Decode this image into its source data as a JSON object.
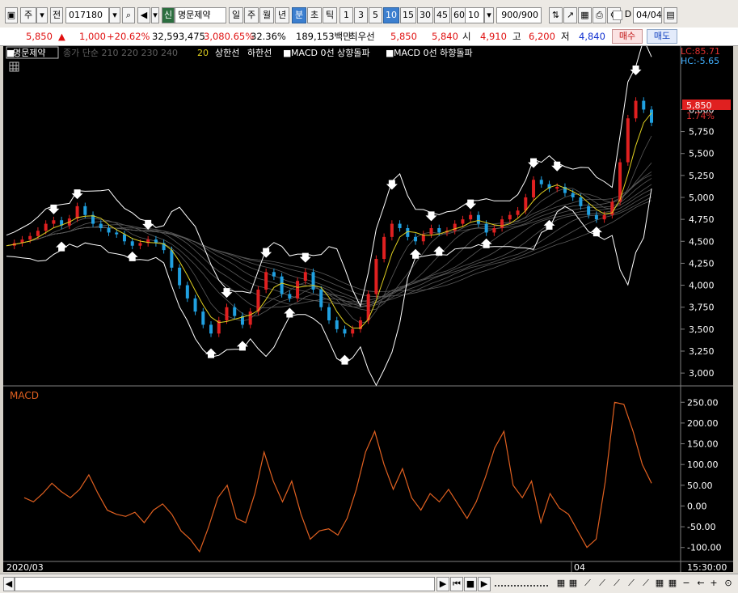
{
  "toolbar": {
    "market_label": "주",
    "prev_label": "전",
    "code": "017180",
    "new_badge": "신",
    "stock_name": "명문제약",
    "period_day": "일",
    "period_week": "주",
    "period_month": "월",
    "period_year": "년",
    "period_minute": "분",
    "period_second": "초",
    "period_tick": "틱",
    "intervals": [
      "1",
      "3",
      "5",
      "10",
      "15",
      "30",
      "45",
      "60"
    ],
    "selected_interval": "10",
    "interval_combo": "10",
    "count_display": "900/900",
    "date_display": "04/04",
    "d_label": "D"
  },
  "quote": {
    "price": "5,850",
    "change_arrow": "▲",
    "change": "1,000",
    "change_pct": "+20.62%",
    "volume": "32,593,475",
    "volume_ratio": "3,080.65%",
    "turnover": "32.36%",
    "amount": "189,153백만",
    "best_label": "최우선",
    "best_ask": "5,850",
    "best_bid": "5,840",
    "open_label": "시",
    "open": "4,910",
    "high_label": "고",
    "high": "6,200",
    "low_label": "저",
    "low": "4,840",
    "buy_button": "매수",
    "sell_button": "매도"
  },
  "chart": {
    "legend_stock": "명문제약",
    "legend_ma": "종가 단순 210  220  230  240",
    "legend_env_period": "20",
    "legend_upper": "상한선",
    "legend_lower": "하한선",
    "legend_macd_up": "MACD 0선 상향돌파",
    "legend_macd_down": "MACD 0선 하향돌파",
    "lc_label": "LC:85.71",
    "hc_label": "HC:-5.65",
    "current_price_tag": "5,850",
    "current_pct_tag": "1.74%",
    "price_ticks": [
      "6,000",
      "5,750",
      "5,500",
      "5,250",
      "5,000",
      "4,750",
      "4,500",
      "4,250",
      "4,000",
      "3,750",
      "3,500",
      "3,250",
      "3,000"
    ],
    "macd_label": "MACD",
    "macd_ticks": [
      "250.00",
      "200.00",
      "150.00",
      "100.00",
      "50.00",
      "0.00",
      "-50.00",
      "-100.00"
    ],
    "date_left": "2020/03",
    "date_mid": "04",
    "time_right": "15:30:00",
    "colors": {
      "up_candle": "#e02020",
      "down_candle": "#20a0e0",
      "envelope": "#ffffff",
      "ma20": "#e0d020",
      "macd_line": "#e06020"
    }
  },
  "chart_data": {
    "type": "line",
    "title": "명문제약",
    "price_series": {
      "name": "close",
      "ylim": [
        2900,
        6400
      ],
      "values": [
        4450,
        4480,
        4520,
        4560,
        4620,
        4700,
        4740,
        4680,
        4760,
        4900,
        4800,
        4700,
        4650,
        4600,
        4580,
        4500,
        4450,
        4480,
        4520,
        4480,
        4400,
        4200,
        4000,
        3850,
        3700,
        3550,
        3450,
        3600,
        3750,
        3650,
        3550,
        3700,
        3950,
        4150,
        4100,
        3900,
        3850,
        4050,
        4150,
        3950,
        3750,
        3600,
        3500,
        3450,
        3500,
        3600,
        3900,
        4300,
        4550,
        4700,
        4650,
        4550,
        4500,
        4580,
        4650,
        4600,
        4620,
        4700,
        4750,
        4800,
        4700,
        4600,
        4650,
        4750,
        4800,
        4850,
        5000,
        5200,
        5150,
        5100,
        5120,
        5050,
        5000,
        4900,
        4800,
        4750,
        4800,
        4950,
        5400,
        5900,
        6100,
        6000,
        5850
      ]
    },
    "macd": {
      "ylim": [
        -120,
        270
      ],
      "values": [
        20,
        10,
        30,
        55,
        35,
        20,
        40,
        75,
        30,
        -10,
        -20,
        -25,
        -15,
        -40,
        -10,
        5,
        -20,
        -60,
        -80,
        -110,
        -50,
        20,
        50,
        -30,
        -40,
        30,
        130,
        60,
        10,
        60,
        -20,
        -80,
        -60,
        -55,
        -70,
        -30,
        40,
        130,
        180,
        100,
        40,
        90,
        20,
        -10,
        30,
        10,
        40,
        5,
        -30,
        10,
        70,
        140,
        180,
        50,
        20,
        60,
        -40,
        30,
        -5,
        -20,
        -60,
        -100,
        -80,
        60,
        250,
        245,
        180,
        100,
        55
      ],
      "zero_line": 0
    },
    "xlabel": "",
    "ylabel": ""
  },
  "statusbar": {
    "nav_prev": "◀",
    "nav_next": "▶",
    "nav_start": "⏮",
    "nav_stop": "■",
    "nav_end": "▶",
    "zoom_minus": "−",
    "zoom_plus": "+"
  }
}
